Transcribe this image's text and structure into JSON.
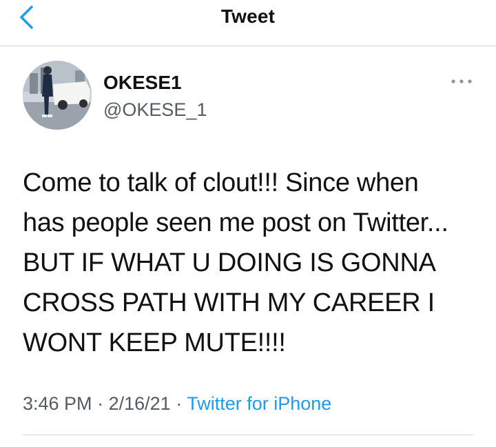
{
  "header": {
    "title": "Tweet"
  },
  "tweet": {
    "display_name": "OKESE1",
    "handle": "@OKESE_1",
    "text_lines": [
      "Come to talk of clout!!! Since when",
      "has people seen me post on Twitter...",
      "BUT IF WHAT U DOING IS GONNA",
      "CROSS PATH WITH MY CAREER I",
      "WONT KEEP MUTE!!!!"
    ],
    "time": "3:46 PM",
    "date": "2/16/21",
    "separator": "·",
    "source": "Twitter for iPhone"
  },
  "icons": {
    "back": "chevron-left-icon",
    "more": "more-horizontal-icon"
  },
  "colors": {
    "accent": "#1d9bf0",
    "secondary_text": "#535b63",
    "divider": "#d6d9db"
  }
}
